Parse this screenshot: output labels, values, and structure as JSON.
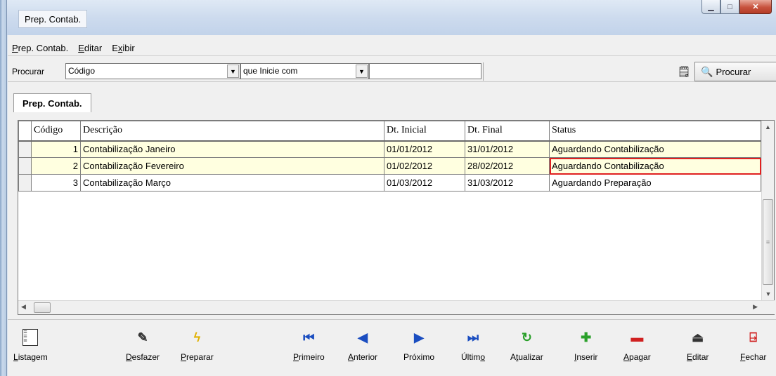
{
  "window": {
    "title": "Prep. Contab."
  },
  "menu": {
    "items": [
      {
        "label": "Prep. Contab.",
        "key": "P",
        "rest": "rep. Contab."
      },
      {
        "label": "Editar",
        "key": "E",
        "rest": "ditar"
      },
      {
        "label": "Exibir",
        "key": "x",
        "pre": "E",
        "rest": "ibir"
      }
    ]
  },
  "search": {
    "label": "Procurar",
    "field": "Código",
    "condition": "que Inicie com",
    "value": "",
    "button_label": "Procurar"
  },
  "tabs": [
    {
      "label": "Prep. Contab."
    }
  ],
  "grid": {
    "columns": [
      "Código",
      "Descrição",
      "Dt. Inicial",
      "Dt. Final",
      "Status"
    ],
    "rows": [
      {
        "code": "1",
        "description": "Contabilização Janeiro",
        "start": "01/01/2012",
        "end": "31/01/2012",
        "status": "Aguardando Contabilização"
      },
      {
        "code": "2",
        "description": "Contabilização Fevereiro",
        "start": "01/02/2012",
        "end": "28/02/2012",
        "status": "Aguardando Contabilização"
      },
      {
        "code": "3",
        "description": "Contabilização Março",
        "start": "01/03/2012",
        "end": "31/03/2012",
        "status": "Aguardando Preparação"
      }
    ]
  },
  "toolbar": {
    "listagem": {
      "key": "L",
      "rest": "istagem"
    },
    "desfazer": {
      "key": "D",
      "rest": "esfazer"
    },
    "preparar": {
      "key": "P",
      "rest": "reparar"
    },
    "primeiro": {
      "key": "P",
      "rest": "rimeiro"
    },
    "anterior": {
      "key": "A",
      "rest": "nterior"
    },
    "proximo": {
      "label": "Próximo"
    },
    "ultimo": {
      "pre": "Últim",
      "key": "o"
    },
    "atualizar": {
      "pre": "A",
      "key": "t",
      "rest": "ualizar"
    },
    "inserir": {
      "key": "I",
      "rest": "nserir"
    },
    "apagar": {
      "key": "A",
      "rest": "pagar"
    },
    "editar": {
      "key": "E",
      "rest": "ditar"
    },
    "fechar": {
      "key": "F",
      "rest": "echar"
    }
  }
}
